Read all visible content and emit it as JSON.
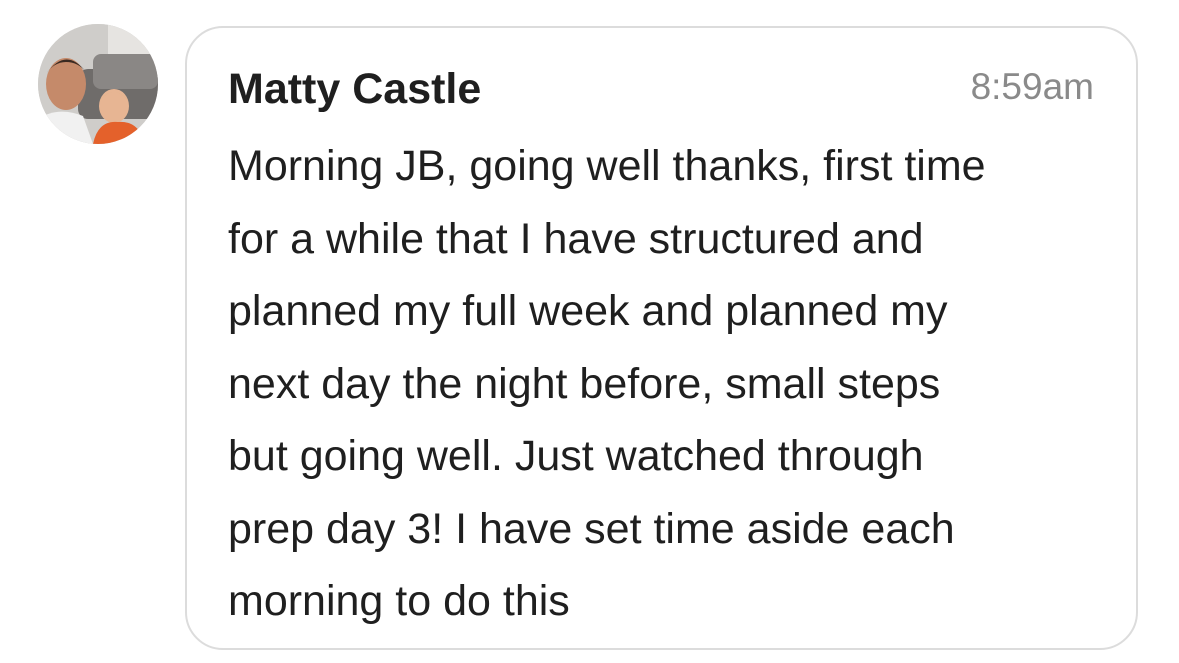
{
  "message": {
    "sender_name": "Matty Castle",
    "timestamp": "8:59am",
    "text": "Morning JB, going well thanks, first time\nfor a while that I have structured and\nplanned my full week and planned my\nnext day the night before, small steps\nbut going well. Just watched through\nprep day 3! I have set time aside each\nmorning to do this"
  },
  "colors": {
    "bubble_border": "#dcdcdc",
    "text_primary": "#1f1f1f",
    "text_secondary": "#8a8a8a"
  }
}
